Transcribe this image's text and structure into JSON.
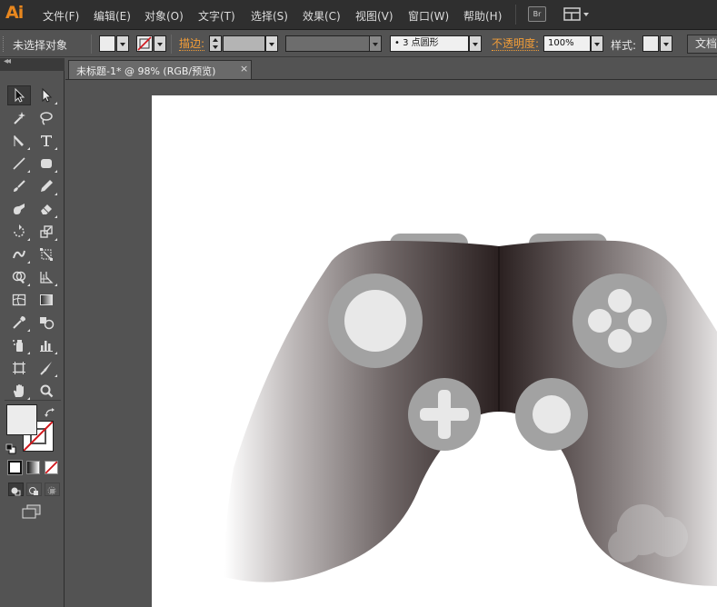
{
  "app": {
    "logo": "Ai"
  },
  "menu": [
    "文件(F)",
    "编辑(E)",
    "对象(O)",
    "文字(T)",
    "选择(S)",
    "效果(C)",
    "视图(V)",
    "窗口(W)",
    "帮助(H)"
  ],
  "menubar_icons": {
    "bridge": "Br",
    "workspace": "workspace-switcher-icon"
  },
  "control": {
    "selection": "未选择对象",
    "stroke_label": "描边:",
    "stroke_value": "",
    "brush": "•  3 点圆形",
    "opacity_label": "不透明度:",
    "opacity_value": "100%",
    "style_label": "样式:",
    "doc_button": "文档"
  },
  "document": {
    "tab_title": "未标题-1* @ 98% (RGB/预览)",
    "close": "×"
  },
  "tools": [
    {
      "name": "selection-tool",
      "icon": "arrow-black"
    },
    {
      "name": "direct-selection-tool",
      "icon": "arrow-white"
    },
    {
      "name": "magic-wand-tool",
      "icon": "wand"
    },
    {
      "name": "lasso-tool",
      "icon": "lasso"
    },
    {
      "name": "pen-tool",
      "icon": "pen"
    },
    {
      "name": "type-tool",
      "icon": "T"
    },
    {
      "name": "line-tool",
      "icon": "line"
    },
    {
      "name": "rectangle-tool",
      "icon": "rect"
    },
    {
      "name": "paintbrush-tool",
      "icon": "brush"
    },
    {
      "name": "pencil-tool",
      "icon": "pencil"
    },
    {
      "name": "blob-brush-tool",
      "icon": "blob"
    },
    {
      "name": "eraser-tool",
      "icon": "eraser"
    },
    {
      "name": "rotate-tool",
      "icon": "rotate"
    },
    {
      "name": "scale-tool",
      "icon": "scale"
    },
    {
      "name": "warp-tool",
      "icon": "warp"
    },
    {
      "name": "free-transform-tool",
      "icon": "free-transform"
    },
    {
      "name": "shape-builder-tool",
      "icon": "shape-builder"
    },
    {
      "name": "perspective-grid-tool",
      "icon": "perspective"
    },
    {
      "name": "mesh-tool",
      "icon": "mesh"
    },
    {
      "name": "gradient-tool",
      "icon": "gradient"
    },
    {
      "name": "eyedropper-tool",
      "icon": "eyedropper"
    },
    {
      "name": "blend-tool",
      "icon": "blend"
    },
    {
      "name": "symbol-sprayer-tool",
      "icon": "sprayer"
    },
    {
      "name": "column-graph-tool",
      "icon": "graph"
    },
    {
      "name": "artboard-tool",
      "icon": "artboard"
    },
    {
      "name": "slice-tool",
      "icon": "slice"
    },
    {
      "name": "hand-tool",
      "icon": "hand"
    },
    {
      "name": "zoom-tool",
      "icon": "zoom"
    }
  ],
  "colors": {
    "fill": "#ececec",
    "controller_dark": "#2c2222",
    "controller_light": "#8a8282",
    "button_gray": "#a2a2a2",
    "button_light": "#e8e8e8",
    "accent_orange": "#f29d38"
  }
}
